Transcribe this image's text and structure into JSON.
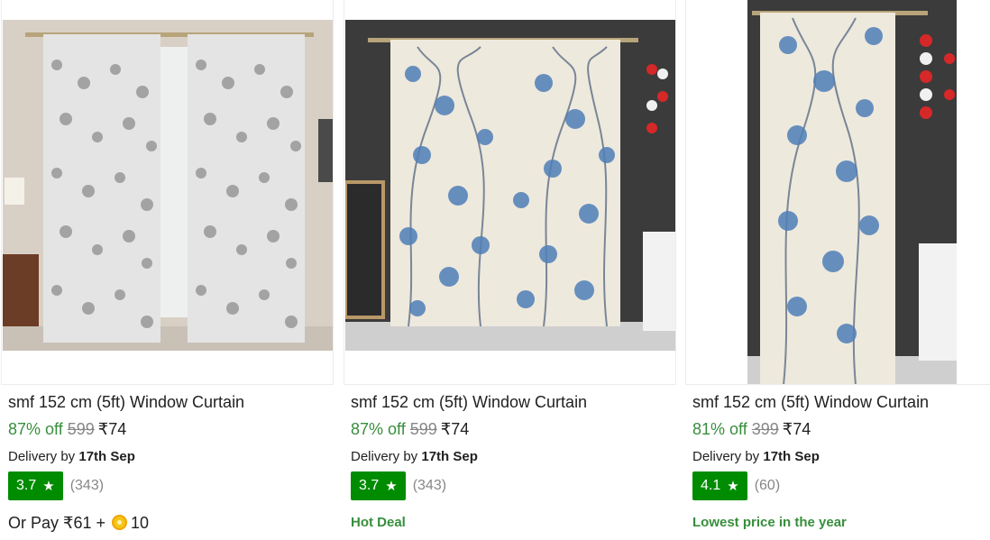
{
  "colors": {
    "green": "#388e3c",
    "badge": "#008c00",
    "muted": "#878787"
  },
  "products": [
    {
      "title": "smf 152 cm (5ft) Window Curtain",
      "discount": "87% off",
      "mrp": "599",
      "price": "₹74",
      "delivery_prefix": "Delivery by",
      "delivery_date": "17th Sep",
      "rating": "3.7",
      "rating_count": "(343)",
      "extra_prefix": "Or Pay ₹61 + ",
      "extra_suffix": "10",
      "image": "grey-floral-sheer-curtain"
    },
    {
      "title": "smf 152 cm (5ft) Window Curtain",
      "discount": "87% off",
      "mrp": "599",
      "price": "₹74",
      "delivery_prefix": "Delivery by",
      "delivery_date": "17th Sep",
      "rating": "3.7",
      "rating_count": "(343)",
      "tag": "Hot Deal",
      "image": "blue-floral-sheer-curtain"
    },
    {
      "title": "smf 152 cm (5ft) Window Curtain",
      "discount": "81% off",
      "mrp": "399",
      "price": "₹74",
      "delivery_prefix": "Delivery by",
      "delivery_date": "17th Sep",
      "rating": "4.1",
      "rating_count": "(60)",
      "tag": "Lowest price in the year",
      "image": "blue-floral-sheer-curtain-single"
    }
  ]
}
